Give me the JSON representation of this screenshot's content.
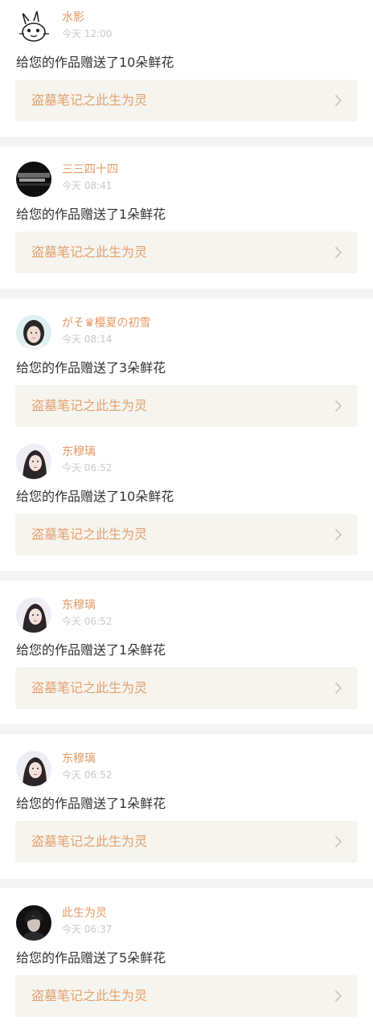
{
  "colors": {
    "username": "#e59a63",
    "time": "#c9c9c9",
    "message": "#333333",
    "work_bg": "#f5f4ee",
    "work_title": "#e5a06d",
    "separator": "#f4f4f4"
  },
  "items": [
    {
      "avatar_icon": "rabbit-doodle-avatar",
      "username": "水影",
      "time": "今天 12:00",
      "message": "给您的作品赠送了10朵鲜花",
      "work_title": "盗墓笔记之此生为灵",
      "chevron_icon": "chevron-right-icon"
    },
    {
      "avatar_icon": "dark-photo-avatar",
      "username": "三三四十四",
      "time": "今天 08:41",
      "message": "给您的作品赠送了1朵鲜花",
      "work_title": "盗墓笔记之此生为灵",
      "chevron_icon": "chevron-right-icon"
    },
    {
      "avatar_icon": "girl-portrait-avatar",
      "username": "がそ♛樱夏の初雪",
      "time": "今天 08:14",
      "message": "给您的作品赠送了3朵鲜花",
      "work_title": "盗墓笔记之此生为灵",
      "chevron_icon": "chevron-right-icon"
    },
    {
      "avatar_icon": "woman-portrait-avatar",
      "username": "东穆璃",
      "time": "今天 06:52",
      "message": "给您的作品赠送了10朵鲜花",
      "work_title": "盗墓笔记之此生为灵",
      "chevron_icon": "chevron-right-icon"
    },
    {
      "avatar_icon": "woman-portrait-avatar",
      "username": "东穆璃",
      "time": "今天 06:52",
      "message": "给您的作品赠送了1朵鲜花",
      "work_title": "盗墓笔记之此生为灵",
      "chevron_icon": "chevron-right-icon"
    },
    {
      "avatar_icon": "woman-portrait-avatar",
      "username": "东穆璃",
      "time": "今天 06:52",
      "message": "给您的作品赠送了1朵鲜花",
      "work_title": "盗墓笔记之此生为灵",
      "chevron_icon": "chevron-right-icon"
    },
    {
      "avatar_icon": "man-portrait-avatar",
      "username": "此生为灵",
      "time": "今天 06:37",
      "message": "给您的作品赠送了5朵鲜花",
      "work_title": "盗墓笔记之此生为灵",
      "chevron_icon": "chevron-right-icon"
    }
  ]
}
